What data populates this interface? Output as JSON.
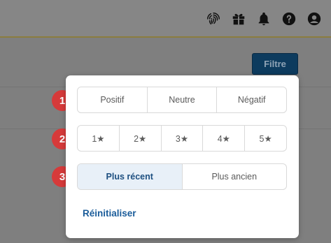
{
  "header": {
    "icons": [
      "fingerprint-icon",
      "gift-icon",
      "bell-icon",
      "help-icon",
      "user-icon"
    ]
  },
  "toolbar": {
    "filter_label": "Filtre"
  },
  "filters": {
    "sentiment": [
      "Positif",
      "Neutre",
      "Négatif"
    ],
    "rating": [
      "1★",
      "2★",
      "3★",
      "4★",
      "5★"
    ],
    "sort": [
      "Plus récent",
      "Plus ancien"
    ],
    "sort_selected": "Plus récent",
    "reset_label": "Réinitialiser"
  },
  "steps": [
    "1",
    "2",
    "3"
  ],
  "colors": {
    "accent": "#1a5c9a",
    "step_badge": "#d63a3a",
    "selected_bg": "#e8f0f8",
    "filter_button": "#0d3b5e"
  }
}
